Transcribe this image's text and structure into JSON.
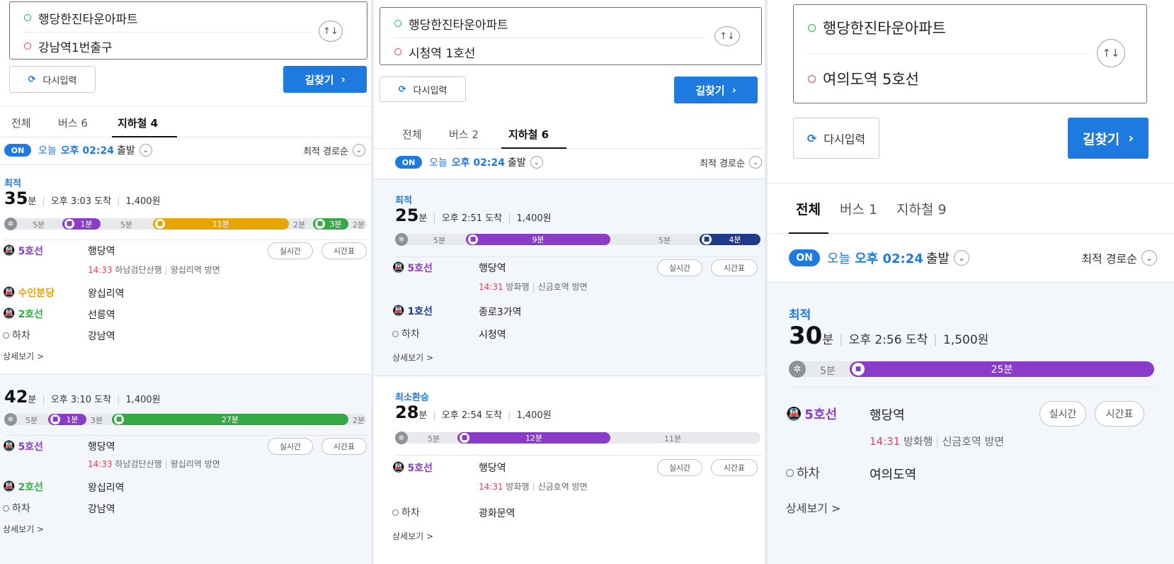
{
  "colors": {
    "accent": "#1f7ae0",
    "line5": "#8a3bc8",
    "suin": "#e8a400",
    "line2": "#37a846",
    "line1": "#1f3a8a",
    "depart_time_red": "#e0445a",
    "walk_gray": "#8e939a"
  },
  "common": {
    "origin": "행당한진타운아파트",
    "reset_label": "다시입력",
    "go_label": "길찾기",
    "go_arrow": "›",
    "tab_all": "전체",
    "depart_on": "ON",
    "depart_day": "오늘",
    "depart_time": "오후 02:24",
    "depart_suffix": "출발",
    "sort_label": "최적 경로순",
    "best_label": "최적",
    "least_transfer_label": "최소환승",
    "realtime": "실시간",
    "timetable": "시간표",
    "detail": "상세보기 >",
    "get_off": "하차",
    "min": "분",
    "swap_icon": "↑↓",
    "reset_icon": "refresh-icon"
  },
  "panel1": {
    "destination": "강남역1번출구",
    "tab_bus": "버스 6",
    "tab_subway": "지하철 4",
    "route1": {
      "minutes": "35",
      "arrive": "오후 3:03 도착",
      "fare": "1,400원",
      "walk1": "5분",
      "seg1": "1분",
      "walk2": "5분",
      "seg2": "11분",
      "walk3": "2분",
      "seg3": "3분",
      "walk4": "2분",
      "steps": [
        {
          "line": "5호선",
          "station": "행당역",
          "sub_time": "14:33",
          "sub_dir": "하남검단산행",
          "sub_toward": "왕십리역 방면"
        },
        {
          "line": "수인분당",
          "station": "왕십리역"
        },
        {
          "line": "2호선",
          "station": "선릉역"
        },
        {
          "line": "하차",
          "station": "강남역"
        }
      ]
    },
    "route2": {
      "minutes": "42",
      "arrive": "오후 3:10 도착",
      "fare": "1,400원",
      "walk1": "5분",
      "seg1": "1분",
      "walk2": "3분",
      "seg2": "27분",
      "walk3": "2분",
      "steps": [
        {
          "line": "5호선",
          "station": "행당역",
          "sub_time": "14:33",
          "sub_dir": "하남검단산행",
          "sub_toward": "왕십리역 방면"
        },
        {
          "line": "2호선",
          "station": "왕십리역"
        },
        {
          "line": "하차",
          "station": "강남역"
        }
      ]
    }
  },
  "panel2": {
    "destination": "시청역 1호선",
    "tab_bus": "버스 2",
    "tab_subway": "지하철 6",
    "route1": {
      "minutes": "25",
      "arrive": "오후 2:51 도착",
      "fare": "1,400원",
      "walk1": "5분",
      "seg1": "9분",
      "walk2": "5분",
      "seg2": "4분",
      "steps": [
        {
          "line": "5호선",
          "station": "행당역",
          "sub_time": "14:31",
          "sub_dir": "방화행",
          "sub_toward": "신금호역 방면"
        },
        {
          "line": "1호선",
          "station": "종로3가역"
        },
        {
          "line": "하차",
          "station": "시청역"
        }
      ]
    },
    "route2": {
      "minutes": "28",
      "arrive": "오후 2:54 도착",
      "fare": "1,400원",
      "walk1": "5분",
      "seg1": "12분",
      "walk2": "11분",
      "steps": [
        {
          "line": "5호선",
          "station": "행당역",
          "sub_time": "14:31",
          "sub_dir": "방화행",
          "sub_toward": "신금호역 방면"
        },
        {
          "line": "하차",
          "station": "광화문역"
        }
      ]
    }
  },
  "panel3": {
    "destination": "여의도역 5호선",
    "tab_bus": "버스 1",
    "tab_subway": "지하철 9",
    "route1": {
      "minutes": "30",
      "arrive": "오후 2:56 도착",
      "fare": "1,500원",
      "walk1": "5분",
      "seg1": "25분",
      "steps": [
        {
          "line": "5호선",
          "station": "행당역",
          "sub_time": "14:31",
          "sub_dir": "방화행",
          "sub_toward": "신금호역 방면"
        },
        {
          "line": "하차",
          "station": "여의도역"
        }
      ]
    }
  }
}
